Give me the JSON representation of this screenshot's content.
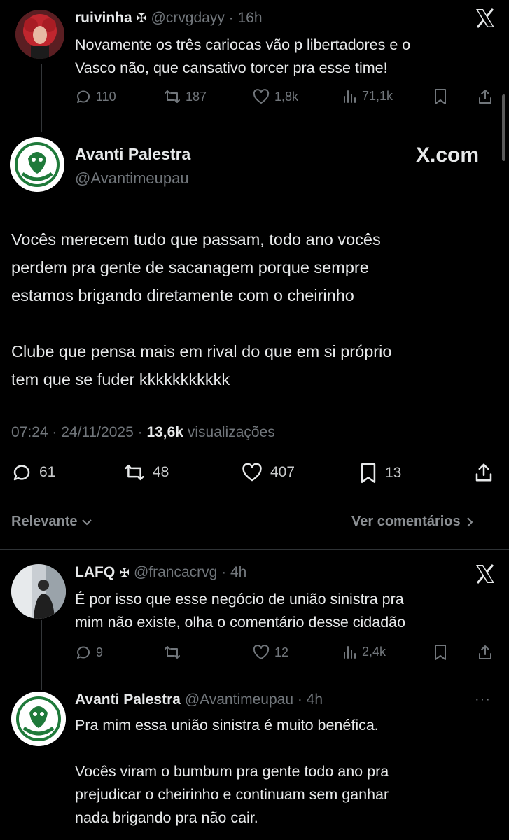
{
  "reply1": {
    "name": "ruivinha",
    "badge": "✠",
    "handle": "@crvgdayy",
    "time": "· 16h",
    "text": "Novamente os três cariocas vão p libertadores e o\nVasco não, que cansativo torcer pra esse time!",
    "replies": "110",
    "reposts": "187",
    "likes": "1,8k",
    "views": "71,1k"
  },
  "main": {
    "name": "Avanti Palestra",
    "handle": "@Avantimeupau",
    "watermark": "X.com",
    "text": "Vocês merecem tudo que passam, todo ano vocês\nperdem pra gente de sacanagem porque sempre\nestamos brigando diretamente com o cheirinho\n\nClube que pensa mais em rival do que em si próprio\ntem que se fuder kkkkkkkkkkk",
    "timestamp": "07:24 · 24/11/2025 ·",
    "views_count": "13,6k",
    "views_label": "visualizações",
    "replies": "61",
    "reposts": "48",
    "likes": "407",
    "bookmarks": "13"
  },
  "sort": {
    "relevant": "Relevante",
    "see_comments": "Ver comentários"
  },
  "reply2": {
    "name": "LAFQ",
    "badge": "✠",
    "handle": "@francacrvg",
    "time": "· 4h",
    "text": "É por isso que esse negócio de união sinistra pra\nmim não existe, olha o comentário desse cidadão",
    "replies": "9",
    "reposts": "",
    "likes": "12",
    "views": "2,4k"
  },
  "reply3": {
    "name": "Avanti Palestra",
    "handle": "@Avantimeupau",
    "time": "· 4h",
    "more": "···",
    "text": "Pra mim essa união sinistra é muito benéfica.\n\nVocês viram o bumbum pra gente todo ano pra\nprejudicar o cheirinho e continuam sem ganhar\nnada brigando pra não cair."
  },
  "colors": {
    "background": "#000000",
    "text": "#e7e9ea",
    "muted": "#71767b",
    "divider": "#2f3336",
    "avatar_green": "#1f7a3a"
  }
}
